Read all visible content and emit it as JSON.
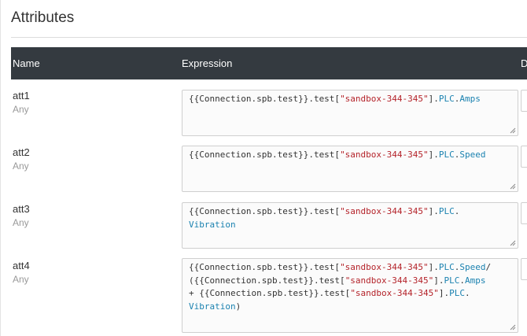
{
  "section": {
    "title": "Attributes"
  },
  "table": {
    "headers": {
      "name": "Name",
      "expression": "Expression",
      "extra": "D"
    }
  },
  "rows": [
    {
      "name": "att1",
      "type": "Any",
      "lines": [
        [
          [
            "plain",
            "{{Connection.spb.test}}.test["
          ],
          [
            "str",
            "\"sandbox-344-345\""
          ],
          [
            "plain",
            "]."
          ],
          [
            "prop",
            "PLC"
          ],
          [
            "plain",
            "."
          ],
          [
            "prop",
            "Amps"
          ]
        ]
      ]
    },
    {
      "name": "att2",
      "type": "Any",
      "lines": [
        [
          [
            "plain",
            "{{Connection.spb.test}}.test["
          ],
          [
            "str",
            "\"sandbox-344-345\""
          ],
          [
            "plain",
            "]."
          ],
          [
            "prop",
            "PLC"
          ],
          [
            "plain",
            "."
          ],
          [
            "prop",
            "Speed"
          ]
        ]
      ]
    },
    {
      "name": "att3",
      "type": "Any",
      "lines": [
        [
          [
            "plain",
            "{{Connection.spb.test}}.test["
          ],
          [
            "str",
            "\"sandbox-344-345\""
          ],
          [
            "plain",
            "]."
          ],
          [
            "prop",
            "PLC"
          ],
          [
            "plain",
            "."
          ]
        ],
        [
          [
            "prop",
            "Vibration"
          ]
        ]
      ]
    },
    {
      "name": "att4",
      "type": "Any",
      "lines": [
        [
          [
            "plain",
            "{{Connection.spb.test}}.test["
          ],
          [
            "str",
            "\"sandbox-344-345\""
          ],
          [
            "plain",
            "]."
          ],
          [
            "prop",
            "PLC"
          ],
          [
            "plain",
            "."
          ],
          [
            "prop",
            "Speed"
          ],
          [
            "plain",
            "/"
          ]
        ],
        [
          [
            "plain",
            "({{Connection.spb.test}}.test["
          ],
          [
            "str",
            "\"sandbox-344-345\""
          ],
          [
            "plain",
            "]."
          ],
          [
            "prop",
            "PLC"
          ],
          [
            "plain",
            "."
          ],
          [
            "prop",
            "Amps"
          ]
        ],
        [
          [
            "plain",
            "+ {{Connection.spb.test}}.test["
          ],
          [
            "str",
            "\"sandbox-344-345\""
          ],
          [
            "plain",
            "]."
          ],
          [
            "prop",
            "PLC"
          ],
          [
            "plain",
            "."
          ]
        ],
        [
          [
            "prop",
            "Vibration"
          ],
          [
            "plain",
            ")"
          ]
        ]
      ]
    }
  ]
}
